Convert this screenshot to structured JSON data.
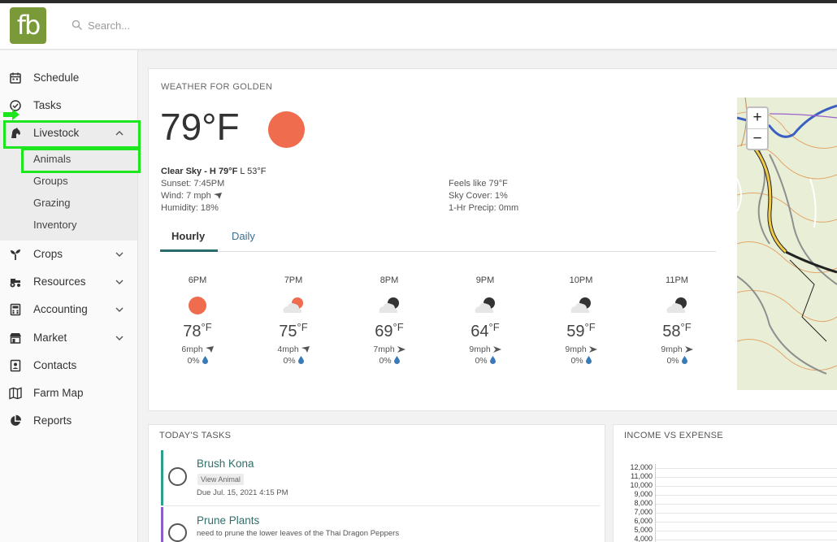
{
  "app": {
    "logo_text": "fb"
  },
  "search": {
    "placeholder": "Search..."
  },
  "sidebar": {
    "items": [
      {
        "label": "Schedule",
        "icon": "calendar-icon"
      },
      {
        "label": "Tasks",
        "icon": "check-circle-icon"
      },
      {
        "label": "Livestock",
        "icon": "horse-icon",
        "expanded": true
      },
      {
        "label": "Crops",
        "icon": "seedling-icon"
      },
      {
        "label": "Resources",
        "icon": "tractor-icon"
      },
      {
        "label": "Accounting",
        "icon": "calculator-icon"
      },
      {
        "label": "Market",
        "icon": "store-icon"
      },
      {
        "label": "Contacts",
        "icon": "address-card-icon"
      },
      {
        "label": "Farm Map",
        "icon": "map-icon"
      },
      {
        "label": "Reports",
        "icon": "pie-chart-icon"
      }
    ],
    "livestock_sub": [
      "Animals",
      "Groups",
      "Grazing",
      "Inventory"
    ]
  },
  "weather": {
    "title": "WEATHER FOR GOLDEN",
    "temp": "79°F",
    "condition": "Clear Sky - H",
    "high": "79°F",
    "low_label": "L",
    "low": "53°F",
    "sunset": "Sunset: 7:45PM",
    "wind": "Wind: 7 mph",
    "humidity": "Humidity: 18%",
    "feels_like": "Feels like 79°F",
    "sky_cover": "Sky Cover: 1%",
    "precip": "1-Hr Precip: 0mm",
    "tabs": [
      "Hourly",
      "Daily"
    ],
    "hourly": [
      {
        "time": "6PM",
        "icon": "sun-icon",
        "temp": "78",
        "unit": "°F",
        "wind": "6mph",
        "wind_dir": "sw",
        "precip": "0%"
      },
      {
        "time": "7PM",
        "icon": "partly-sunny-icon",
        "temp": "75",
        "unit": "°F",
        "wind": "4mph",
        "wind_dir": "sw",
        "precip": "0%"
      },
      {
        "time": "8PM",
        "icon": "partly-cloudy-night-icon",
        "temp": "69",
        "unit": "°F",
        "wind": "7mph",
        "wind_dir": "e",
        "precip": "0%"
      },
      {
        "time": "9PM",
        "icon": "partly-cloudy-night-icon",
        "temp": "64",
        "unit": "°F",
        "wind": "9mph",
        "wind_dir": "e",
        "precip": "0%"
      },
      {
        "time": "10PM",
        "icon": "partly-cloudy-night-icon",
        "temp": "59",
        "unit": "°F",
        "wind": "9mph",
        "wind_dir": "e",
        "precip": "0%"
      },
      {
        "time": "11PM",
        "icon": "partly-cloudy-night-icon",
        "temp": "58",
        "unit": "°F",
        "wind": "9mph",
        "wind_dir": "e",
        "precip": "0%"
      }
    ],
    "map_zoom_in": "+",
    "map_zoom_out": "−"
  },
  "tasks": {
    "title": "TODAY'S TASKS",
    "items": [
      {
        "name": "Brush Kona",
        "badge": "View Animal",
        "date": "Due Jul. 15, 2021 4:15 PM",
        "color": "#2e9e8e"
      },
      {
        "name": "Prune Plants",
        "desc": "need to prune the lower leaves of the Thai Dragon Peppers",
        "color": "#8a5fc7"
      }
    ]
  },
  "income": {
    "title": "INCOME VS EXPENSE",
    "yticks": [
      "12,000",
      "11,000",
      "10,000",
      "9,000",
      "8,000",
      "7,000",
      "6,000",
      "5,000",
      "4,000"
    ]
  },
  "colors": {
    "brand": "#7a9a3a",
    "highlight": "#1ee61e",
    "sun": "#ef6d4e",
    "accent": "#2a6b6e"
  }
}
